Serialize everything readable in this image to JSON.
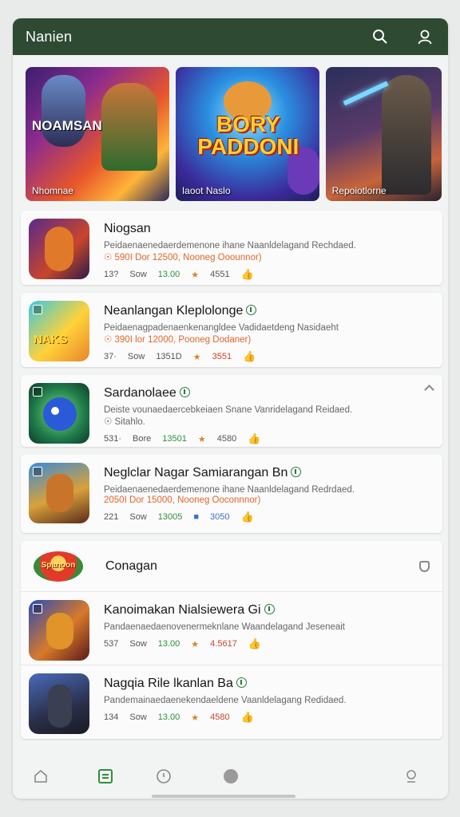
{
  "header": {
    "title": "Nanien"
  },
  "banners": [
    {
      "headline": "NOAMSAN",
      "caption": "Nhomnae"
    },
    {
      "headline": "BORY PADDONI",
      "caption": "Iaoot Naslo"
    },
    {
      "headline": "",
      "caption": "Repoiotlorne"
    }
  ],
  "games": [
    {
      "name": "Niogsan",
      "desc": "Peidaenaenedaerdemenone ihane Naanldelagand Rechdaed.",
      "promo": "☉ 590I Dor 12500, Nooneg Ooounnor)",
      "stats": {
        "a": "13?",
        "b": "Sow",
        "c": "13.00",
        "d": "4551"
      }
    },
    {
      "name": "Neanlangan Kleplolonge",
      "desc": "Peidaenagpadenaenkenangldee Vadidaetdeng Nasidaeht",
      "promo": "☉ 390I lor 12000, Pooneg Dodaner)",
      "stats": {
        "a": "37·",
        "b": "Sow",
        "c": "1351D",
        "d": "3551"
      }
    },
    {
      "name": "Sardanolaee",
      "desc": "Deiste vounaedaercebkeiaen Snane Vanridelagand Reidaed.",
      "promo": "☉ Sitahlo.",
      "stats": {
        "a": "531·",
        "b": "Bore",
        "c": "13501",
        "d": "4580"
      }
    },
    {
      "name": "Neglclar Nagar Samiarangan Bn",
      "desc": "Peidaenaenedaerdemenone ihane Naanldelagand Redrdaed.",
      "promo": "2050I Dor 15000, Nooneg Ooconnnor)",
      "stats": {
        "a": "221",
        "b": "Sow",
        "c": "13005",
        "d": "3050"
      }
    }
  ],
  "section": {
    "title": "Conagan",
    "logo_text": "Spanoon",
    "games": [
      {
        "name": "Kanoimakan Nialsiewera Gi",
        "desc": "Pandaenaedaenovenermeknlane Waandelagand Jeseneait",
        "stats": {
          "a": "537",
          "b": "Sow",
          "c": "13.00",
          "d": "4.5617"
        }
      },
      {
        "name": "Nagqia Rile lkanlan Ba",
        "desc": "Pandemainaedaenekendaeldene Vaanldelagang Redidaed.",
        "stats": {
          "a": "134",
          "b": "Sow",
          "c": "13.00",
          "d": "4580"
        }
      }
    ]
  },
  "colors": {
    "topbar": "#2e4a33",
    "accent_green": "#2f8f3c",
    "promo_orange": "#e0662a"
  },
  "icons": {
    "search": "search-icon",
    "profile": "profile-icon",
    "home": "home-icon",
    "library": "library-icon",
    "alerts": "alert-icon",
    "record": "record-icon",
    "account": "account-icon"
  }
}
